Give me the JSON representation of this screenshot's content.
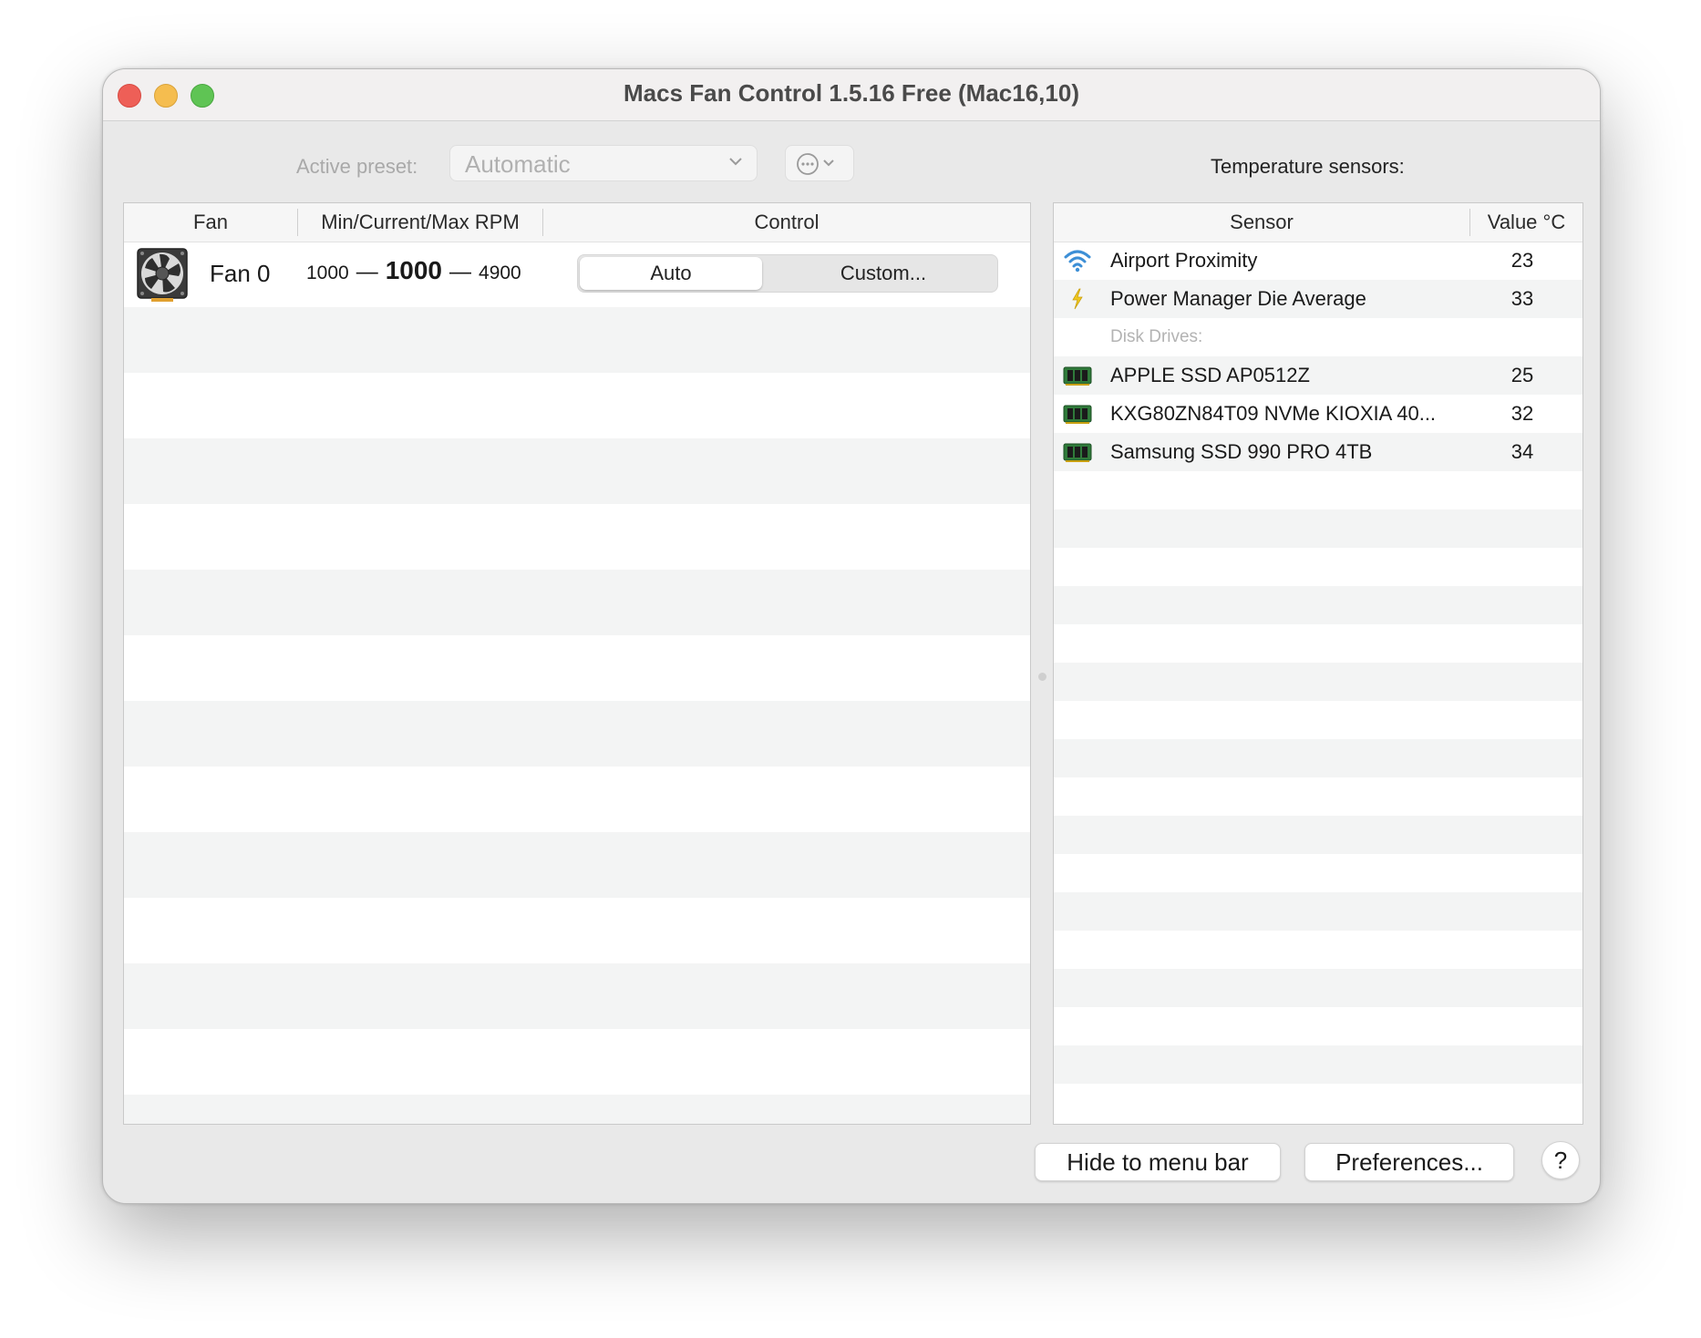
{
  "window": {
    "title": "Macs Fan Control 1.5.16 Free (Mac16,10)"
  },
  "toolbar": {
    "preset_label": "Active preset:",
    "preset_value": "Automatic",
    "more_icon": "ellipsis-circle-icon"
  },
  "fans": {
    "columns": [
      "Fan",
      "Min/Current/Max RPM",
      "Control"
    ],
    "items": [
      {
        "name": "Fan 0",
        "min_rpm": "1000",
        "current_rpm": "1000",
        "max_rpm": "4900",
        "dash": "—",
        "control_options": [
          "Auto",
          "Custom..."
        ],
        "selected_control": "Auto"
      }
    ]
  },
  "sensors": {
    "title": "Temperature sensors:",
    "columns": [
      "Sensor",
      "Value °C"
    ],
    "items": [
      {
        "name": "Airport Proximity",
        "value": "23",
        "icon": "wifi-icon"
      },
      {
        "name": "Power Manager Die Average",
        "value": "33",
        "icon": "lightning-icon"
      }
    ],
    "disk_group_label": "Disk Drives:",
    "disks": [
      {
        "name": "APPLE SSD AP0512Z",
        "value": "25",
        "icon": "drive-chip-icon"
      },
      {
        "name": "KXG80ZN84T09 NVMe KIOXIA 40...",
        "value": "32",
        "icon": "drive-chip-icon"
      },
      {
        "name": "Samsung SSD 990 PRO 4TB",
        "value": "34",
        "icon": "drive-chip-icon"
      }
    ]
  },
  "footer": {
    "hide_label": "Hide to menu bar",
    "preferences_label": "Preferences...",
    "help_label": "?"
  },
  "colors": {
    "close": "#ee5f57",
    "minimize": "#f5bd4f",
    "maximize": "#5fc454",
    "stripe": "#f3f4f4",
    "wifi": "#3d8fd6",
    "lightning": "#f0c81e",
    "drive_chip": "#2f7a3a"
  }
}
